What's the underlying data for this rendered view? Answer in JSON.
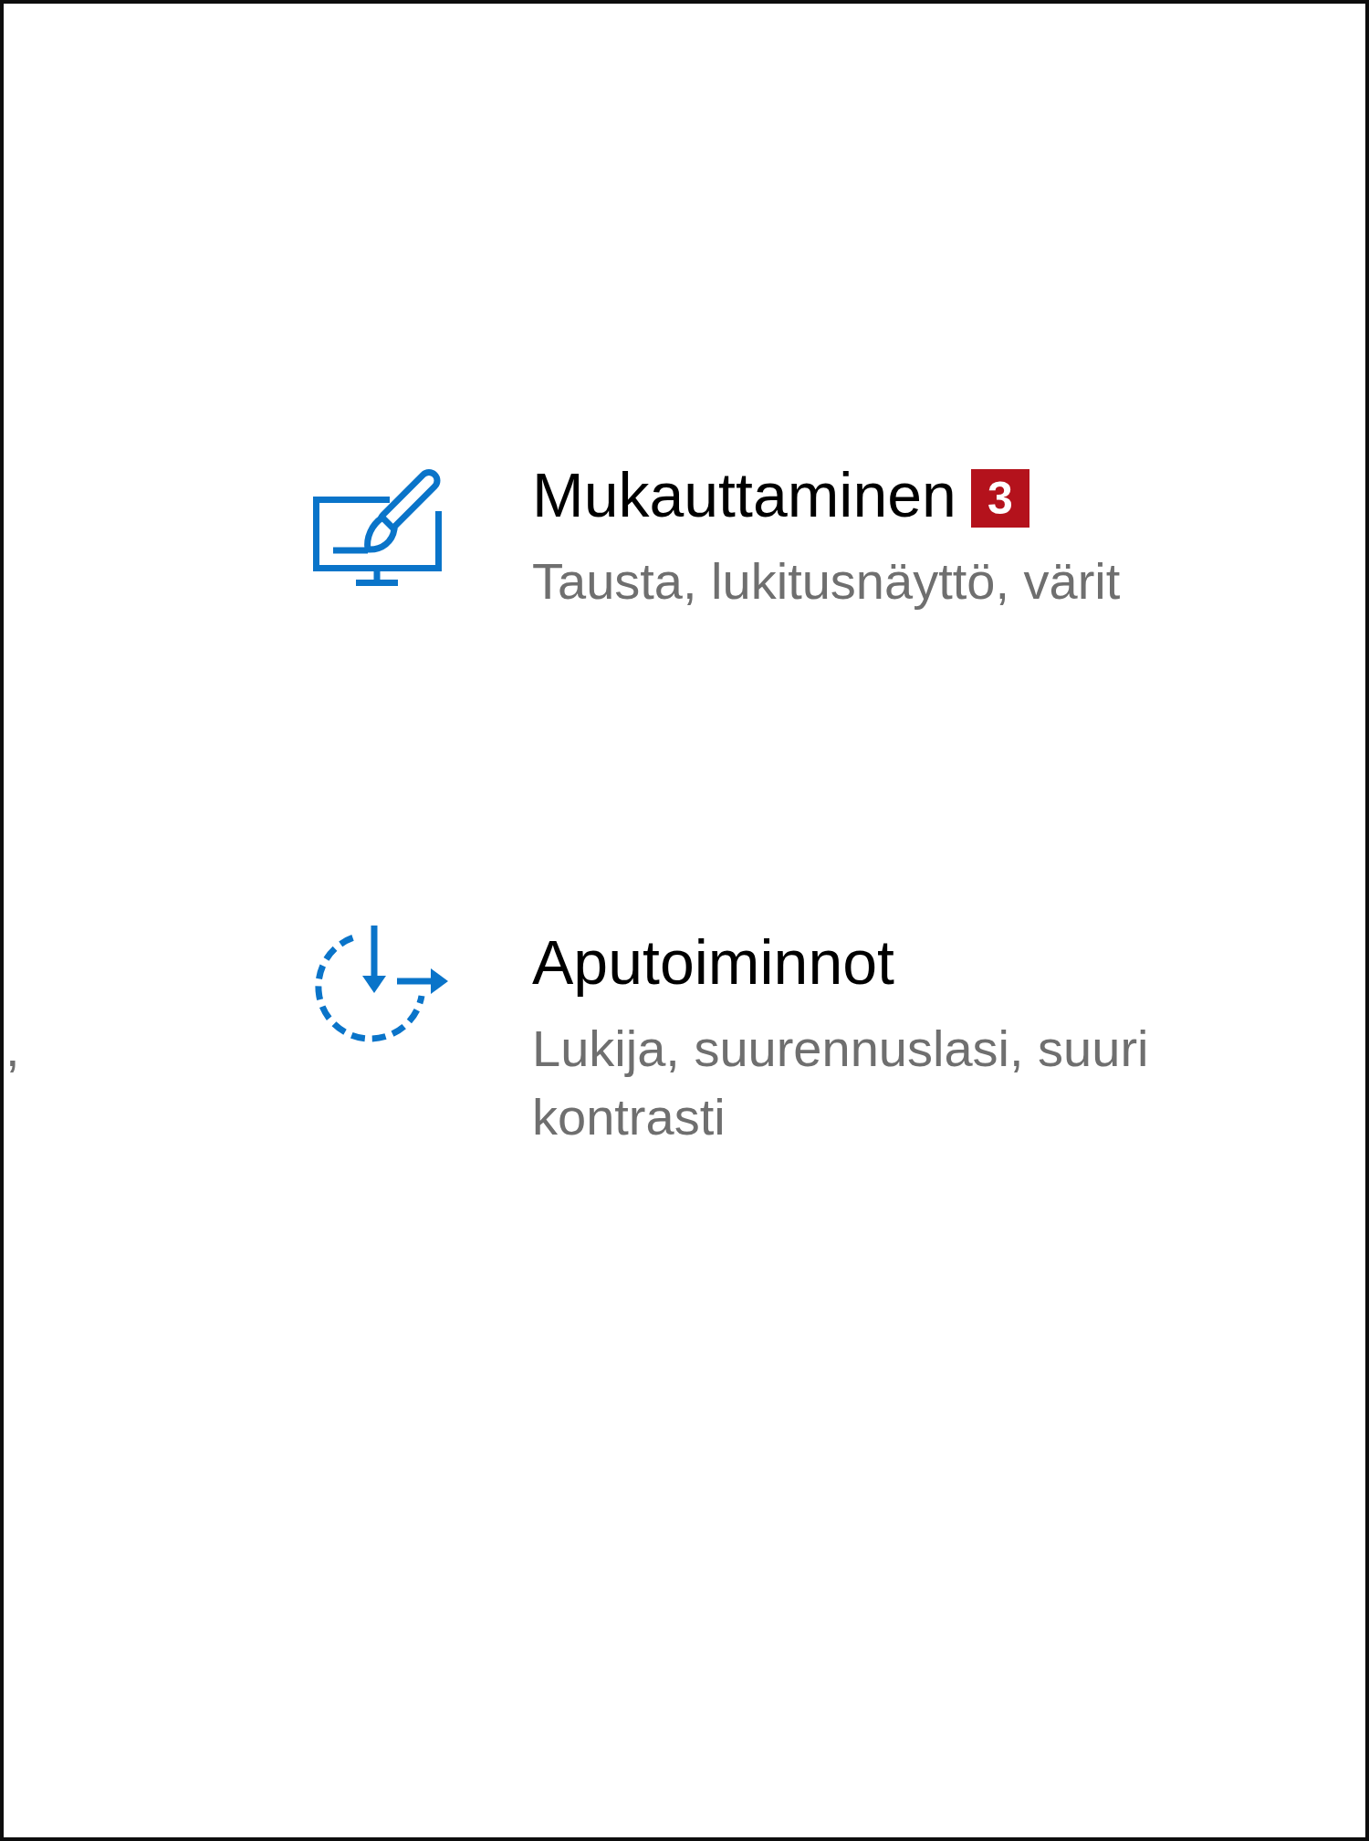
{
  "tiles": [
    {
      "kind": "personalization",
      "title": "Mukauttaminen",
      "badge": "3",
      "subtitle": "Tausta, lukitusnäyttö, värit"
    },
    {
      "kind": "accessibility",
      "title": "Aputoiminnot",
      "subtitle": "Lukija, suurennuslasi, suuri kontrasti"
    }
  ],
  "cut_off_text": ","
}
